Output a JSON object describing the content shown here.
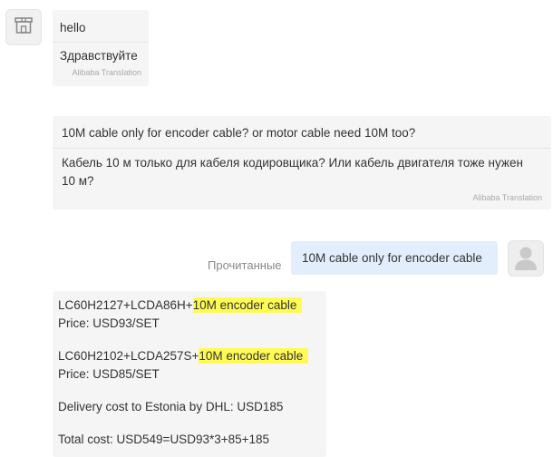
{
  "messages": {
    "seller_1": {
      "original": "hello",
      "translated": "Здравствуйте",
      "translation_label": "Alibaba Translation"
    },
    "seller_2": {
      "original": "10M cable only for encoder cable? or motor cable need 10M too?",
      "translated": "Кабель 10 м только для кабеля кодировщика? Или кабель двигателя тоже нужен 10 м?",
      "translation_label": "Alibaba Translation"
    },
    "buyer_1": {
      "text": "10M cable only for encoder cable",
      "status": "Прочитанные"
    },
    "seller_3": {
      "line1_model": "LC60H2127+LCDA86H+",
      "line1_highlight": "10M encoder cable",
      "line1_price": "Price: USD93/SET",
      "line2_model": "LC60H2102+LCDA257S+",
      "line2_highlight": "10M encoder cable",
      "line2_price": "Price: USD85/SET",
      "delivery": "Delivery cost to Estonia by DHL: USD185",
      "total": "Total cost: USD549=USD93*3+85+185"
    }
  },
  "colors": {
    "bubble_incoming": "#f5f5f5",
    "bubble_outgoing": "#e2eefb",
    "highlight": "#fffb55",
    "status_text": "#888888"
  },
  "icons": {
    "seller_avatar": "store-icon",
    "buyer_avatar": "user-icon"
  }
}
